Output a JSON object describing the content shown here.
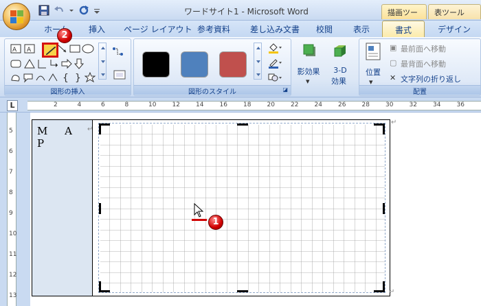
{
  "title": {
    "window": "ワードサイト1 - Microsoft Word"
  },
  "context_tabs": {
    "draw": "描画ツール",
    "table": "表ツール"
  },
  "tabs": [
    "ホーム",
    "挿入",
    "ページ レイアウト",
    "参考資料",
    "差し込み文書",
    "校閲",
    "表示",
    "書式",
    "デザイン"
  ],
  "active_tab": "書式",
  "groups": {
    "insert_shapes": "図形の挿入",
    "shape_styles": "図形のスタイル",
    "arrange": "配置"
  },
  "buttons": {
    "shadow": "影効果",
    "threed_line1": "3-D",
    "threed_line2": "効果",
    "position": "位置",
    "bring_front": "最前面へ移動",
    "send_back": "最背面へ移動",
    "wrap": "文字列の折り返し"
  },
  "ruler": {
    "marks": [
      "2",
      "4",
      "6",
      "8",
      "10",
      "12",
      "14",
      "16",
      "18",
      "20",
      "22",
      "24",
      "26",
      "28",
      "30",
      "32",
      "34",
      "36"
    ]
  },
  "vruler": {
    "marks": [
      "5",
      "6",
      "7",
      "8",
      "9",
      "10",
      "11",
      "12",
      "13"
    ]
  },
  "document": {
    "map_title": "M A P"
  },
  "colors": {
    "swatch_black": "#000000",
    "swatch_blue": "#4f81bd",
    "swatch_red": "#c0504d",
    "badge": "#d00000"
  },
  "annotations": {
    "step1": "1",
    "step2": "2"
  }
}
